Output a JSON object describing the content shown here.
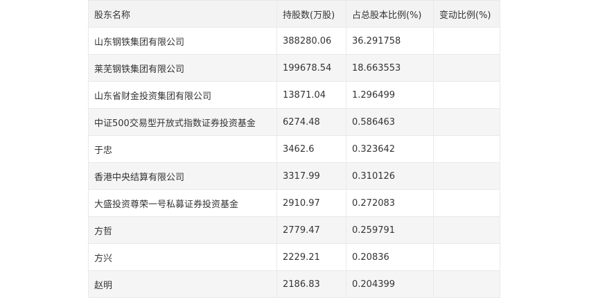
{
  "table": {
    "headers": [
      "股东名称",
      "持股数(万股)",
      "占总股本比例(%)",
      "变动比例(%)"
    ],
    "rows": [
      {
        "name": "山东钢铁集团有限公司",
        "shares": "388280.06",
        "ratio": "36.291758",
        "change": ""
      },
      {
        "name": "莱芜钢铁集团有限公司",
        "shares": "199678.54",
        "ratio": "18.663553",
        "change": ""
      },
      {
        "name": "山东省财金投资集团有限公司",
        "shares": "13871.04",
        "ratio": "1.296499",
        "change": ""
      },
      {
        "name": "中证500交易型开放式指数证券投资基金",
        "shares": "6274.48",
        "ratio": "0.586463",
        "change": ""
      },
      {
        "name": "于忠",
        "shares": "3462.6",
        "ratio": "0.323642",
        "change": ""
      },
      {
        "name": "香港中央结算有限公司",
        "shares": "3317.99",
        "ratio": "0.310126",
        "change": ""
      },
      {
        "name": "大盛投资尊荣一号私募证券投资基金",
        "shares": "2910.97",
        "ratio": "0.272083",
        "change": ""
      },
      {
        "name": "方哲",
        "shares": "2779.47",
        "ratio": "0.259791",
        "change": ""
      },
      {
        "name": "方兴",
        "shares": "2229.21",
        "ratio": "0.20836",
        "change": ""
      },
      {
        "name": "赵明",
        "shares": "2186.83",
        "ratio": "0.204399",
        "change": ""
      }
    ]
  }
}
